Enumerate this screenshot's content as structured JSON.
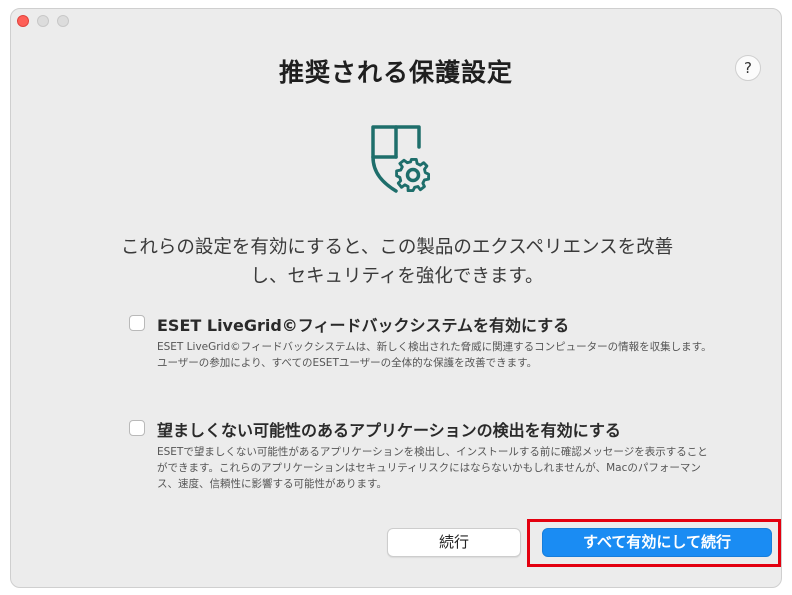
{
  "window": {
    "title": "推奨される保護設定",
    "help_label": "?"
  },
  "icons": {
    "hero": "shield-gear-icon",
    "accent_color": "#1e6e6b"
  },
  "lead_text": {
    "line1": "これらの設定を有効にすると、この製品のエクスペリエンスを改善",
    "line2": "し、セキュリティを強化できます。"
  },
  "options": [
    {
      "title": "ESET LiveGrid©フィードバックシステムを有効にする",
      "description": "ESET LiveGrid©フィードバックシステムは、新しく検出された脅威に関連するコンピューターの情報を収集します。ユーザーの参加により、すべてのESETユーザーの全体的な保護を改善できます。",
      "checked": false
    },
    {
      "title": "望ましくない可能性のあるアプリケーションの検出を有効にする",
      "description": "ESETで望ましくない可能性があるアプリケーションを検出し、インストールする前に確認メッセージを表示することができます。これらのアプリケーションはセキュリティリスクにはならないかもしれませんが、Macのパフォーマンス、速度、信頼性に影響する可能性があります。",
      "checked": false
    }
  ],
  "buttons": {
    "continue_label": "続行",
    "enable_all_label": "すべて有効にして続行"
  },
  "colors": {
    "primary_button": "#1a8cf3",
    "highlight": "#e3000f"
  }
}
